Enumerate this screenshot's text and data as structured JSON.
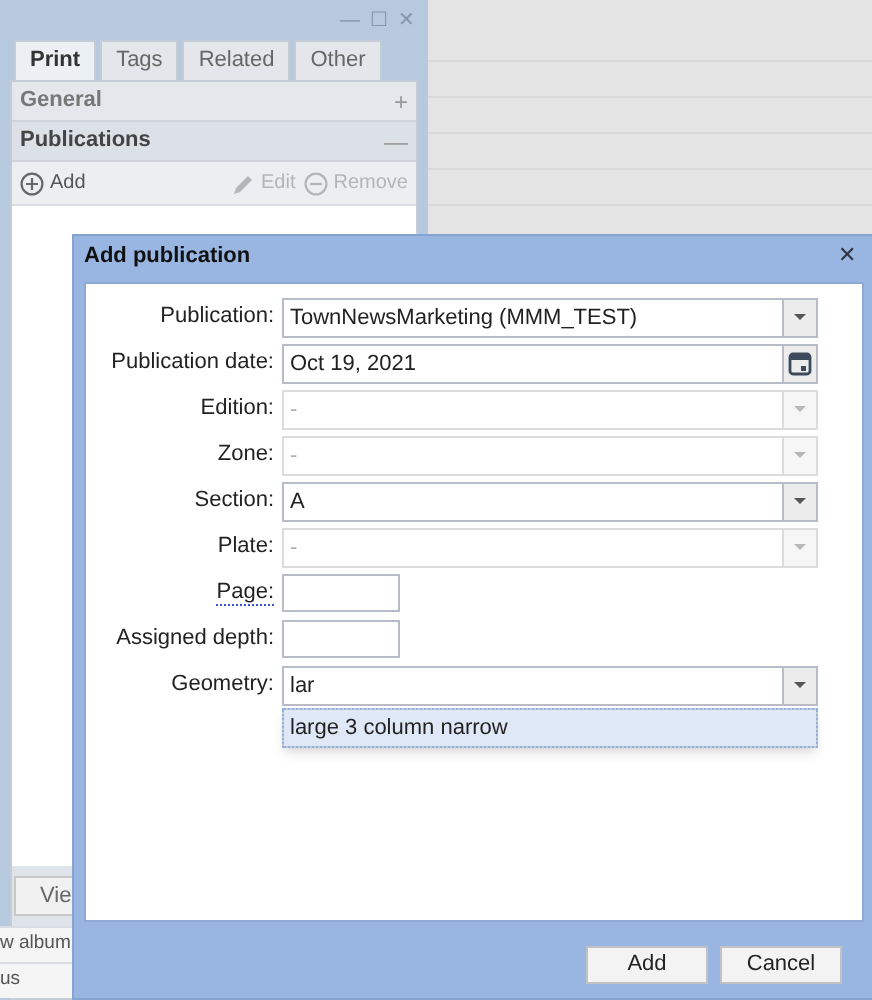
{
  "panel": {
    "window_controls": [
      "—",
      "☐",
      "✕"
    ],
    "tabs": [
      {
        "label": "Print",
        "selected": true
      },
      {
        "label": "Tags",
        "selected": false
      },
      {
        "label": "Related",
        "selected": false
      },
      {
        "label": "Other",
        "selected": false
      }
    ],
    "sections": [
      {
        "title": "General",
        "expanded": false,
        "toggle": "+"
      },
      {
        "title": "Publications",
        "expanded": true,
        "toggle": "—"
      }
    ],
    "toolbar": [
      {
        "label": "Add",
        "kind": "add",
        "disabled": false
      },
      {
        "label": "Edit",
        "kind": "edit",
        "disabled": true
      },
      {
        "label": "Remove",
        "kind": "remove",
        "disabled": true
      }
    ],
    "bottom_button": "Vie",
    "bottom_rows": [
      "w album",
      "us"
    ]
  },
  "dialog": {
    "title": "Add publication",
    "close": "✕",
    "fields": [
      {
        "label": "Publication:",
        "kind": "combo",
        "value": "TownNewsMarketing (MMM_TEST)",
        "disabled": false
      },
      {
        "label": "Publication date:",
        "kind": "date",
        "value": "Oct 19, 2021",
        "disabled": false
      },
      {
        "label": "Edition:",
        "kind": "combo",
        "value": "-",
        "disabled": true
      },
      {
        "label": "Zone:",
        "kind": "combo",
        "value": "-",
        "disabled": true
      },
      {
        "label": "Section:",
        "kind": "combo",
        "value": "A",
        "disabled": false
      },
      {
        "label": "Plate:",
        "kind": "combo",
        "value": "-",
        "disabled": true
      },
      {
        "label": "Page:",
        "kind": "short",
        "hint": true,
        "disabled": false
      },
      {
        "label": "Assigned depth:",
        "kind": "short",
        "disabled": false
      },
      {
        "label": "Geometry:",
        "kind": "combo",
        "value": "lar",
        "disabled": false,
        "open": true,
        "suggestions": [
          {
            "label": "large 3 column narrow",
            "selected": true
          }
        ]
      }
    ],
    "buttons": [
      "Add",
      "Cancel"
    ]
  }
}
